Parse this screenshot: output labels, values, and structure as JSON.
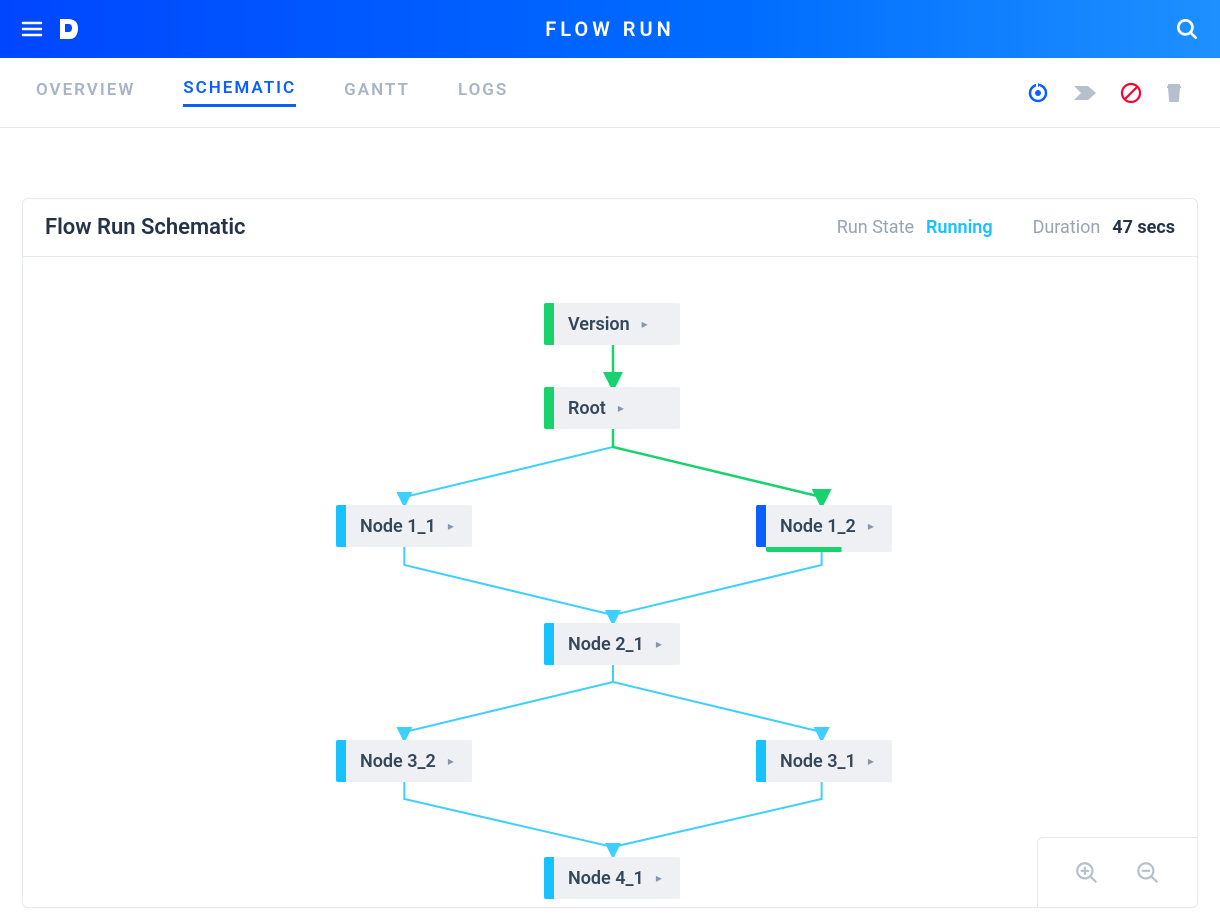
{
  "header": {
    "title": "FLOW RUN"
  },
  "tabs": {
    "overview": "OVERVIEW",
    "schematic": "SCHEMATIC",
    "gantt": "GANTT",
    "logs": "LOGS"
  },
  "card": {
    "title": "Flow Run Schematic",
    "run_state_label": "Run State",
    "run_state_value": "Running",
    "duration_label": "Duration",
    "duration_value": "47 secs"
  },
  "nodes": {
    "version": "Version",
    "root": "Root",
    "n11": "Node 1_1",
    "n12": "Node 1_2",
    "n21": "Node 2_1",
    "n32": "Node 3_2",
    "n31": "Node 3_1",
    "n41": "Node 4_1"
  },
  "colors": {
    "brand": "#0b5fff",
    "cyan": "#16c2ff",
    "green": "#18d26e",
    "red": "#ff0033",
    "mutedText": "#98a4b5"
  }
}
